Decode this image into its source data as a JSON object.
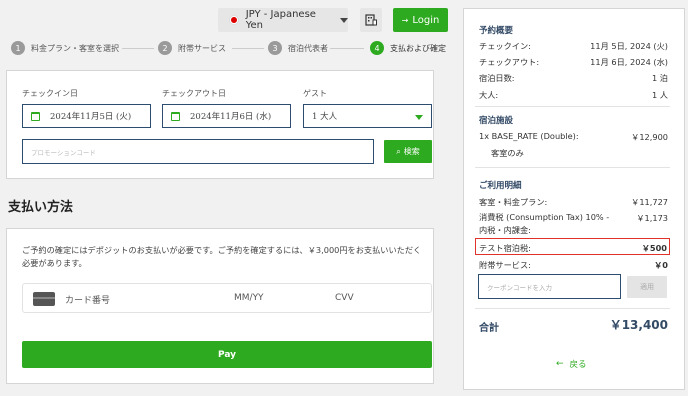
{
  "topbar": {
    "currency_label": "JPY - Japanese Yen",
    "login_label": "Login"
  },
  "steps": [
    {
      "num": "1",
      "label": "料金プラン・客室を選択"
    },
    {
      "num": "2",
      "label": "附帯サービス"
    },
    {
      "num": "3",
      "label": "宿泊代表者"
    },
    {
      "num": "4",
      "label": "支払および確定"
    }
  ],
  "search": {
    "checkin_label": "チェックイン日",
    "checkin_value": "2024年11月5日 (火)",
    "checkout_label": "チェックアウト日",
    "checkout_value": "2024年11月6日 (水)",
    "guest_label": "ゲスト",
    "guest_value": "1 大人",
    "promo_placeholder": "プロモーションコード",
    "apply_label": "検索"
  },
  "payment": {
    "title": "支払い方法",
    "deposit_text": "ご予約の確定にはデポジットのお支払いが必要です。ご予約を確定するには、￥3,000円をお支払いいただく必要があります。",
    "card_number_placeholder": "カード番号",
    "expiry_placeholder": "MM/YY",
    "cvv_placeholder": "CVV",
    "pay_label": "Pay"
  },
  "summary": {
    "title": "予約概要",
    "rows": [
      {
        "label": "チェックイン:",
        "value": "11月 5日, 2024 (火)"
      },
      {
        "label": "チェックアウト:",
        "value": "11月 6日, 2024 (水)"
      },
      {
        "label": "宿泊日数:",
        "value": "1 泊"
      },
      {
        "label": "大人:",
        "value": "1 人"
      }
    ],
    "facility_title": "宿泊施設",
    "room_label": "1x BASE_RATE (Double):",
    "room_value": "￥12,900",
    "room_note": "客室のみ",
    "details_title": "ご利用明細",
    "room_charge_label": "客室・料金プラン:",
    "room_charge_value": "￥11,727",
    "tax_label": "消費税 (Consumption Tax) 10% - 内税・内課金:",
    "tax_value": "￥1,173",
    "lodging_tax_label": "テスト宿泊税:",
    "lodging_tax_value": "￥500",
    "extras_label": "附帯サービス:",
    "extras_value": "￥0",
    "coupon_placeholder": "クーポンコードを入力",
    "coupon_apply": "適用",
    "total_label": "合計",
    "total_value": "￥13,400",
    "back_label": "戻る"
  },
  "colors": {
    "accent": "#2daa1f",
    "heading": "#334a66",
    "highlight_border": "#e0312a"
  }
}
